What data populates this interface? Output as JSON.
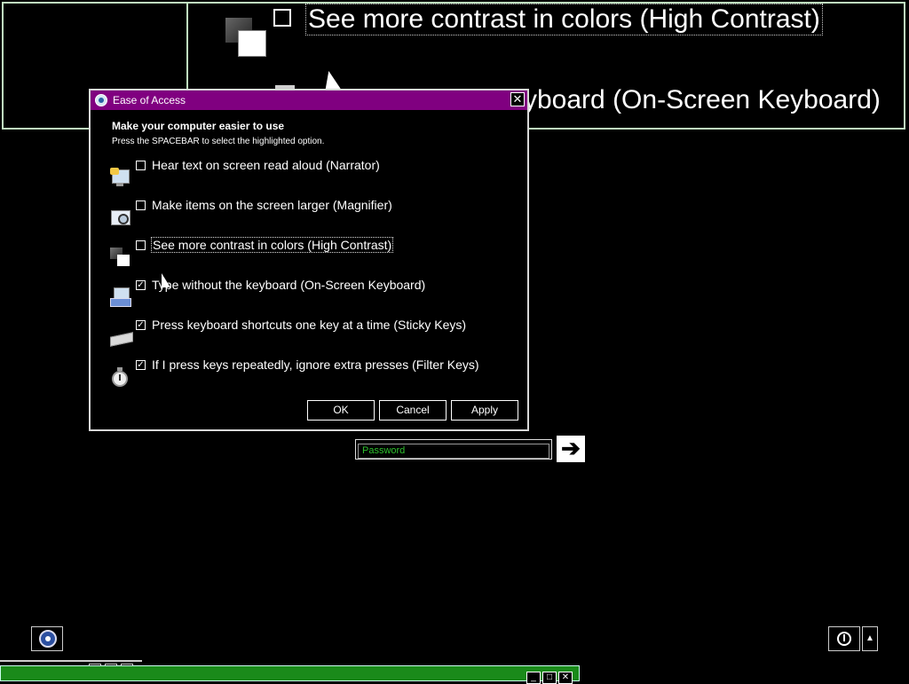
{
  "background_magnifier": {
    "line1": "See more contrast in colors (High Contrast)",
    "line2": "yboard (On-Screen Keyboard)"
  },
  "dialog": {
    "title": "Ease of Access",
    "close": "✕",
    "heading": "Make your computer easier to use",
    "subheading": "Press the SPACEBAR to select the highlighted option.",
    "options": [
      {
        "label": "Hear text on screen read aloud (Narrator)",
        "checked": false,
        "icon": "narrator-icon"
      },
      {
        "label": "Make items on the screen larger (Magnifier)",
        "checked": false,
        "icon": "magnifier-icon"
      },
      {
        "label": "See more contrast in colors (High Contrast)",
        "checked": false,
        "icon": "high-contrast-icon",
        "focused": true
      },
      {
        "label": "Type without the keyboard (On-Screen Keyboard)",
        "checked": true,
        "icon": "on-screen-keyboard-icon"
      },
      {
        "label": "Press keyboard shortcuts one key at a time (Sticky Keys)",
        "checked": true,
        "icon": "sticky-keys-icon"
      },
      {
        "label": "If I press keys repeatedly, ignore extra presses (Filter Keys)",
        "checked": true,
        "icon": "filter-keys-icon"
      }
    ],
    "buttons": {
      "ok": "OK",
      "cancel": "Cancel",
      "apply": "Apply"
    }
  },
  "login": {
    "password_placeholder": "Password",
    "submit_glyph": "➔"
  },
  "bottom": {
    "power_arrow": "▲"
  },
  "colors": {
    "titlebar": "#800080",
    "background": "#000000",
    "password_text": "#2ec22e",
    "taskbar_window": "#1a8a1a"
  }
}
